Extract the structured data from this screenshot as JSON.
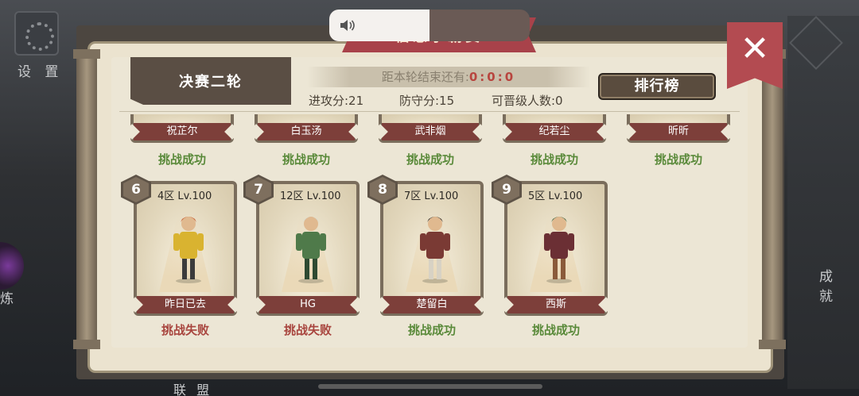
{
  "background": {
    "settings_label": "设 置",
    "refine_label": "炼",
    "achievement_label": "成 就",
    "alliance_label": "联 盟"
  },
  "title": {
    "text": "信志争霸赛"
  },
  "volume": {
    "icon": "speaker-icon",
    "level_pct": 50
  },
  "round_label": "决赛二轮",
  "timer": {
    "prefix": "距本轮结束还有:",
    "time": "0:0:0"
  },
  "stats": {
    "attack": "进攻分:21",
    "defense": "防守分:15",
    "promotable": "可晋级人数:0"
  },
  "leaderboard_button": "排行榜",
  "close_icon": "close-icon",
  "colors": {
    "win": "#5a8a3a",
    "lose": "#a8453e",
    "ribbon": "#a8424a"
  },
  "top_row": [
    {
      "name": "祝芷尔",
      "result": "挑战成功",
      "status": "win"
    },
    {
      "name": "白玉汤",
      "result": "挑战成功",
      "status": "win"
    },
    {
      "name": "武非烟",
      "result": "挑战成功",
      "status": "win"
    },
    {
      "name": "纪若尘",
      "result": "挑战成功",
      "status": "win"
    },
    {
      "name": "昕昕",
      "result": "挑战成功",
      "status": "win"
    }
  ],
  "bottom_row": [
    {
      "rank": "6",
      "level": "4区 Lv.100",
      "name": "昨日已去",
      "result": "挑战失败",
      "status": "lose",
      "palette": [
        "#c65a2e",
        "#d9b330",
        "#3b3b3b"
      ]
    },
    {
      "rank": "7",
      "level": "12区 Lv.100",
      "name": "HG",
      "result": "挑战失败",
      "status": "lose",
      "palette": [
        "#d9dccf",
        "#4f7a4a",
        "#2e4a32"
      ]
    },
    {
      "rank": "8",
      "level": "7区 Lv.100",
      "name": "楚留白",
      "result": "挑战成功",
      "status": "win",
      "palette": [
        "#3a3530",
        "#7a3a34",
        "#d8d2c4"
      ]
    },
    {
      "rank": "9",
      "level": "5区 Lv.100",
      "name": "西斯",
      "result": "挑战成功",
      "status": "win",
      "palette": [
        "#4a6b4a",
        "#6b2f34",
        "#8a5a3a"
      ]
    }
  ]
}
